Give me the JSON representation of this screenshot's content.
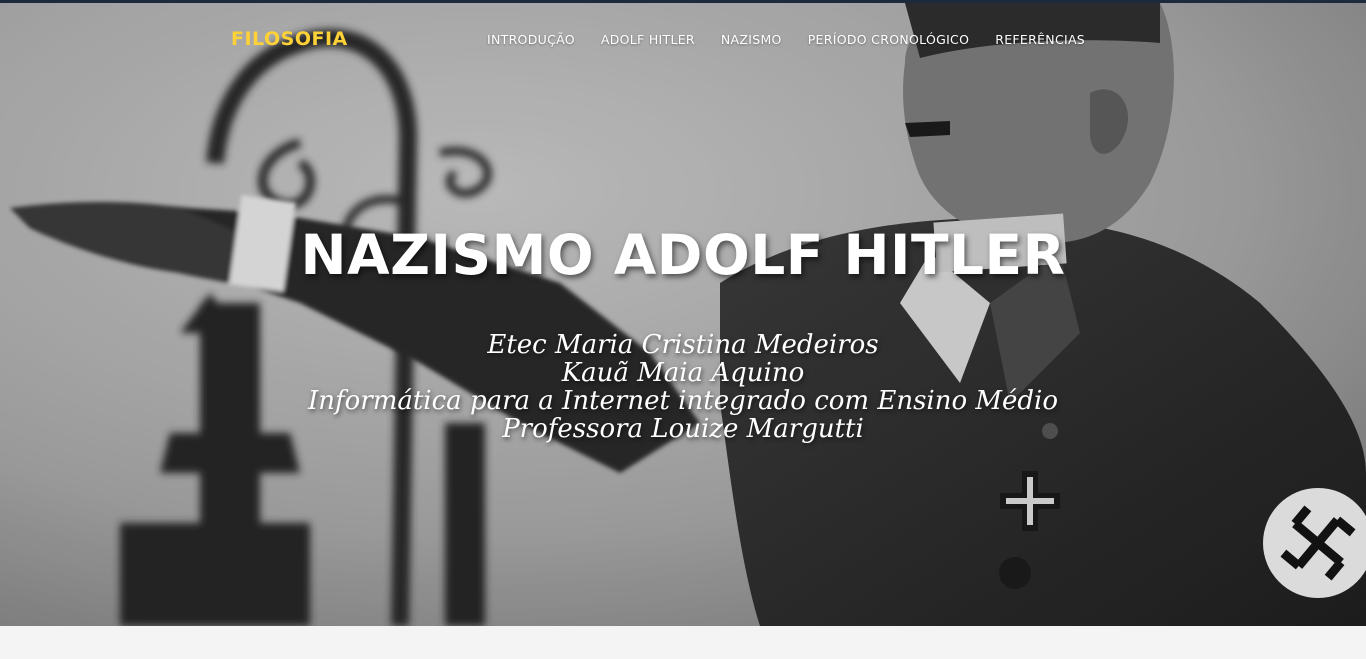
{
  "navbar": {
    "brand": "FILOSOFIA",
    "items": [
      {
        "label": "INTRODUÇÃO"
      },
      {
        "label": "ADOLF HITLER"
      },
      {
        "label": "NAZISMO"
      },
      {
        "label": "PERÍODO CRONOLÓGICO"
      },
      {
        "label": "REFERÊNCIAS"
      }
    ]
  },
  "hero": {
    "title": "NAZISMO ADOLF HITLER",
    "subtitle_lines": [
      "Etec Maria Cristina Medeiros",
      "Kauã Maia Aquino",
      "Informática para a Internet integrado com Ensino Médio",
      "Professora Louize Margutti"
    ]
  },
  "colors": {
    "brand": "#fed136",
    "nav_text": "#ffffff",
    "top_border": "#1d2a3d",
    "page_bg": "#f4f4f4"
  }
}
